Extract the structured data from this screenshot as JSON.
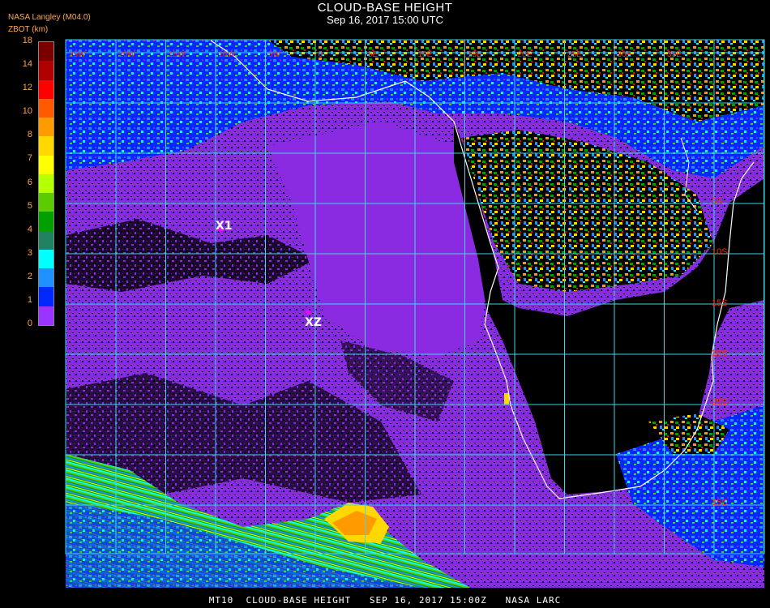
{
  "header": {
    "title": "CLOUD-BASE HEIGHT",
    "subtitle": "Sep 16, 2017 15:00 UTC",
    "credit": "NASA Langley (M04.0)",
    "units": "ZBOT (km)"
  },
  "legend": {
    "ticks": [
      "18",
      "14",
      "12",
      "10",
      "8",
      "7",
      "6",
      "5",
      "4",
      "3",
      "2",
      "1",
      "0"
    ],
    "colors": [
      "#7a0000",
      "#b00000",
      "#ff0000",
      "#ff5a00",
      "#ff9a00",
      "#ffd800",
      "#ffff00",
      "#b4ff00",
      "#5acc00",
      "#00a000",
      "#208060",
      "#00ffff",
      "#1e90ff",
      "#0028ff",
      "#9933ff"
    ]
  },
  "map": {
    "lon_labels": [
      "25W",
      "20W",
      "15W",
      "10W",
      "5W",
      "0",
      "5E",
      "10E",
      "15E",
      "20E",
      "25E",
      "30E",
      "35E"
    ],
    "lat_labels": [
      "5S",
      "10S",
      "15S",
      "20S",
      "25S",
      "35S"
    ],
    "markers": [
      "X1",
      "XZ"
    ],
    "colors": {
      "grid": "#3fd6e6",
      "coast": "#ffffff",
      "low_cloud": "#8a2be2",
      "clear": "#000000",
      "lat_label": "#ff2a00"
    }
  },
  "footer": {
    "text": "MT10  CLOUD-BASE HEIGHT   SEP 16, 2017 15:00Z   NASA LARC"
  }
}
